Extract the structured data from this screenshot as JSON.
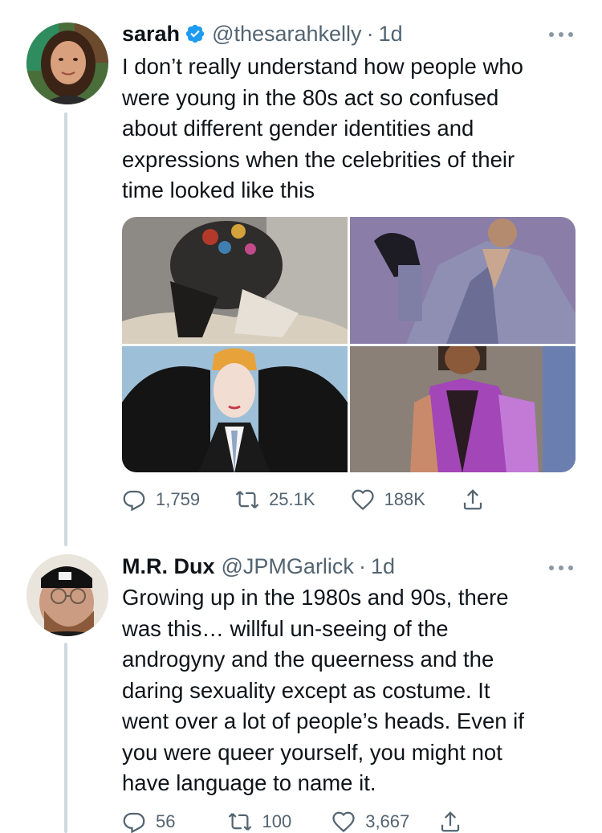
{
  "tweets": [
    {
      "name": "sarah",
      "verified": true,
      "handle": "@thesarahkelly",
      "separator": "·",
      "time": "1d",
      "text": "I don’t really understand how people who\nwere young in the 80s act so confused\nabout different gender identities and\nexpressions when the celebrities of their\ntime looked like this",
      "replies": "1,759",
      "retweets": "25.1K",
      "likes": "188K"
    },
    {
      "name": "M.R. Dux",
      "verified": false,
      "handle": "@JPMGarlick",
      "separator": "·",
      "time": "1d",
      "text": "Growing up in the 1980s and 90s, there\nwas this… willful un-seeing of the\nandrogyny and the queerness and the\ndaring sexuality except as costume. It\nwent over a lot of people’s heads. Even if\nyou were queer yourself, you might not\nhave language to name it.",
      "replies": "56",
      "retweets": "100",
      "likes": "3,667"
    }
  ],
  "colors": {
    "verified": "#1d9bf0",
    "secondary_text": "#536471",
    "thread_line": "#cfd9de"
  },
  "icons": [
    "reply-icon",
    "retweet-icon",
    "like-icon",
    "share-icon",
    "more-icon",
    "verified-icon"
  ]
}
